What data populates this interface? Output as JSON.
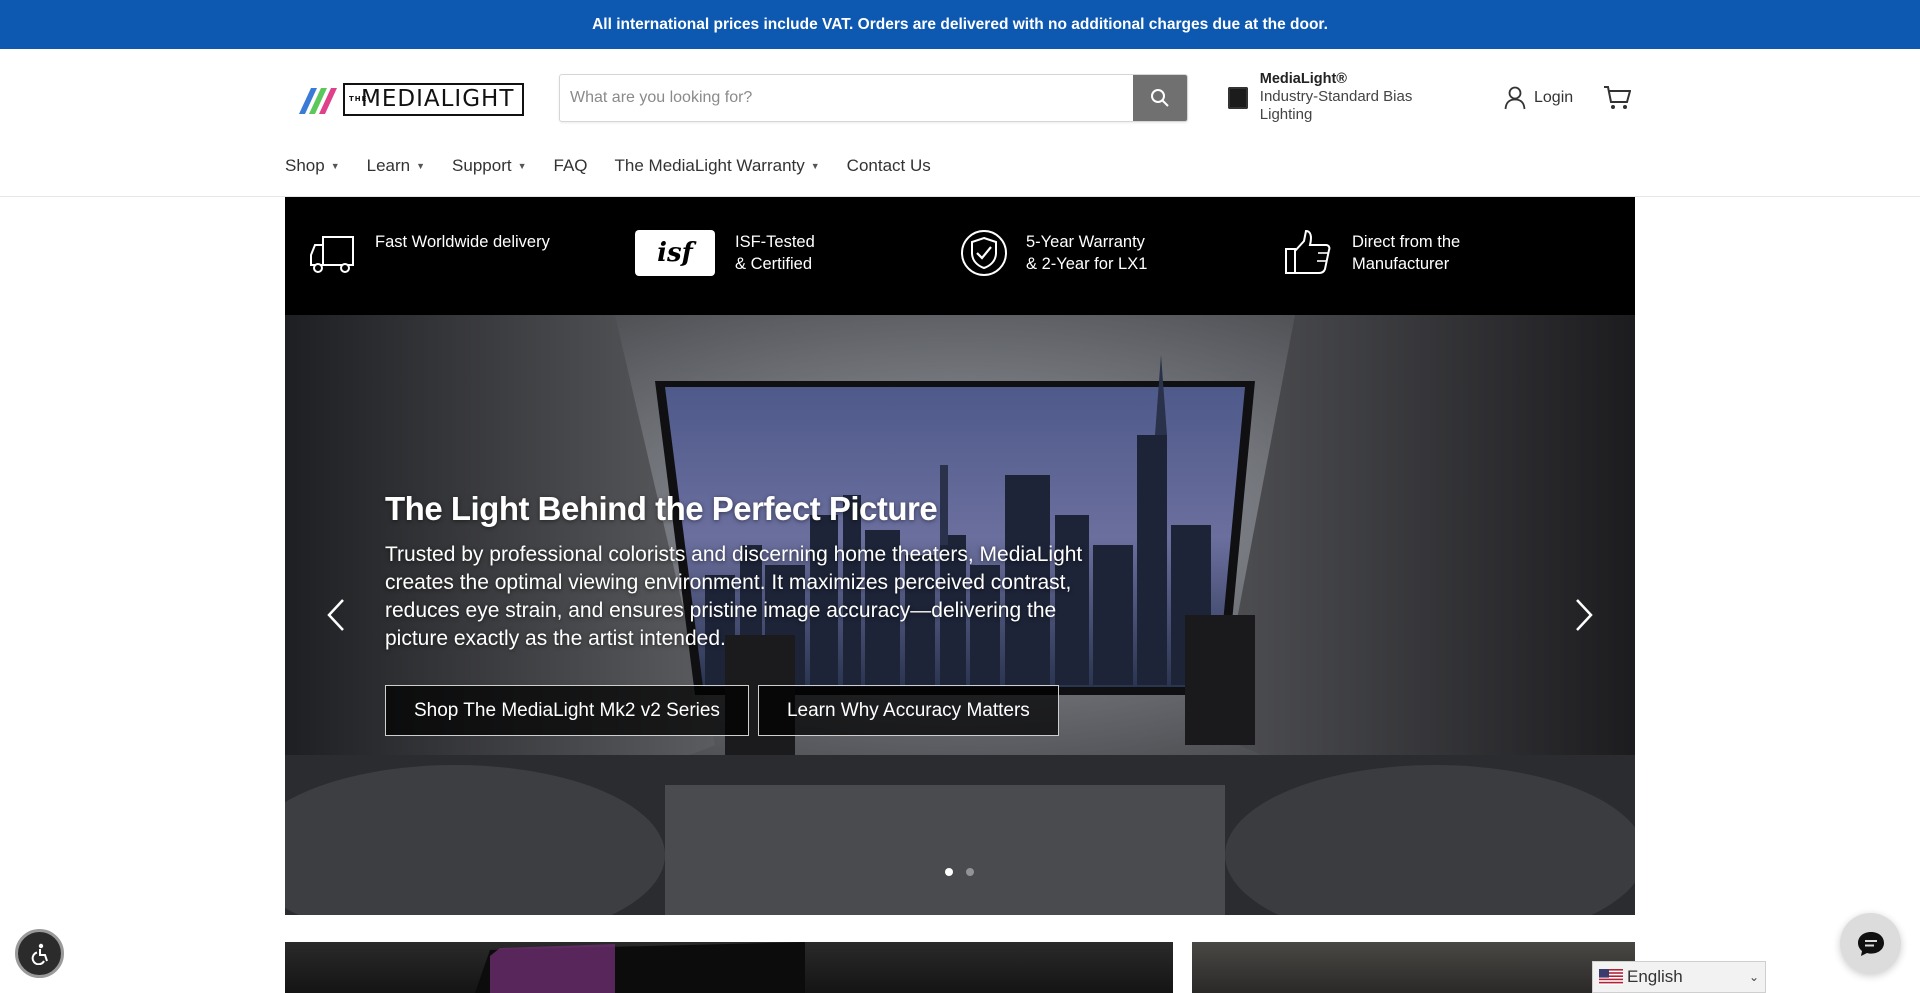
{
  "announcement": "All international prices include VAT. Orders are delivered with no additional charges due at the door.",
  "logo": {
    "the": "THE",
    "text": "MEDIALIGHT"
  },
  "search": {
    "placeholder": "What are you looking for?",
    "value": ""
  },
  "promo": {
    "title": "MediaLight®",
    "subtitle": "Industry-Standard Bias Lighting"
  },
  "account": {
    "login_label": "Login"
  },
  "nav": {
    "items": [
      {
        "label": "Shop",
        "dropdown": true
      },
      {
        "label": "Learn",
        "dropdown": true
      },
      {
        "label": "Support",
        "dropdown": true
      },
      {
        "label": "FAQ",
        "dropdown": false
      },
      {
        "label": "The MediaLight Warranty",
        "dropdown": true
      },
      {
        "label": "Contact Us",
        "dropdown": false
      }
    ]
  },
  "features": [
    {
      "icon": "truck-icon",
      "line1": "Fast Worldwide delivery",
      "line2": ""
    },
    {
      "icon": "isf-logo-icon",
      "line1": "ISF-Tested",
      "line2": "& Certified",
      "badge": "isf"
    },
    {
      "icon": "check-shield-icon",
      "line1": "5-Year Warranty",
      "line2": "& 2-Year for LX1"
    },
    {
      "icon": "thumbs-up-icon",
      "line1": "Direct from the",
      "line2": "Manufacturer"
    }
  ],
  "hero": {
    "title": "The Light Behind the Perfect Picture",
    "body": "Trusted by professional colorists and discerning home theaters, MediaLight creates the optimal viewing environment. It maximizes perceived contrast, reduces eye strain, and ensures pristine image accuracy—delivering the picture exactly as the artist intended.",
    "button_primary": "Shop The MediaLight Mk2 v2 Series",
    "button_secondary": "Learn Why Accuracy Matters",
    "slides_total": 2,
    "active_slide": 1
  },
  "language": {
    "selected": "English"
  },
  "colors": {
    "announcement_bg": "#0d58b0",
    "feature_bar_bg": "#000000",
    "search_button": "#707070"
  }
}
